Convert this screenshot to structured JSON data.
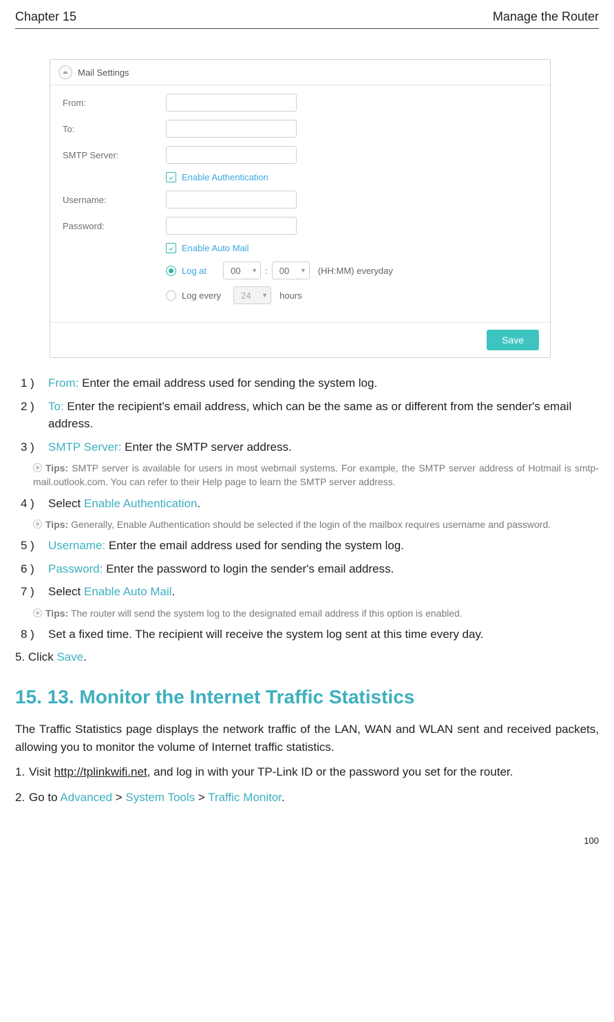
{
  "header": {
    "chapter": "Chapter 15",
    "title": "Manage the Router"
  },
  "panel": {
    "title": "Mail Settings",
    "labels": {
      "from": "From:",
      "to": "To:",
      "smtp": "SMTP Server:",
      "enable_auth": "Enable Authentication",
      "username": "Username:",
      "password": "Password:",
      "enable_automail": "Enable Auto Mail",
      "log_at": "Log at",
      "hh": "00",
      "mm": "00",
      "hhmm_suffix": "(HH:MM) everyday",
      "log_every": "Log every",
      "every_val": "24",
      "every_unit": "hours",
      "save": "Save"
    }
  },
  "steps_sub": [
    {
      "n": "1 )",
      "label": "From:",
      "text": " Enter the email address used for sending the system log."
    },
    {
      "n": "2 )",
      "label": "To:",
      "text": " Enter the recipient's email address, which can be the same as or different from the sender's email address."
    },
    {
      "n": "3 )",
      "label": "SMTP Server:",
      "text": " Enter the SMTP server address."
    }
  ],
  "tips1": {
    "label": "Tips:",
    "text": " SMTP server is available for users in most webmail systems. For example, the SMTP server address of Hotmail is smtp-mail.outlook.com. You can refer to their Help page to learn the SMTP server address."
  },
  "step4": {
    "n": "4 )",
    "pre": "Select ",
    "label": "Enable Authentication",
    "post": "."
  },
  "tips2": {
    "label": "Tips:",
    "text": " Generally, Enable Authentication should be selected if the login of the mailbox requires username and password."
  },
  "steps_sub2": [
    {
      "n": "5 )",
      "label": "Username:",
      "text": " Enter the email address used for sending the system log."
    },
    {
      "n": "6 )",
      "label": "Password:",
      "text": " Enter the password to login the sender's email address."
    }
  ],
  "step7": {
    "n": "7 )",
    "pre": "Select ",
    "label": "Enable Auto Mail",
    "post": "."
  },
  "tips3": {
    "label": "Tips:",
    "text": " The router will send the system log to the designated email address if this option is enabled."
  },
  "step8": {
    "n": "8 )",
    "text": "Set a fixed time. The recipient will receive the system log sent at this time every day."
  },
  "step5outer": {
    "pre": "5. Click ",
    "label": "Save",
    "post": "."
  },
  "section_heading": "15. 13.  Monitor the Internet Traffic Statistics",
  "section_para": "The Traffic Statistics page displays the network traffic of the LAN, WAN and WLAN sent and received packets, allowing you to monitor the volume of Internet traffic statistics.",
  "final_steps": {
    "s1": {
      "n": "1.",
      "pre": "Visit ",
      "link": "http://tplinkwifi.net",
      "post": ", and log in with your TP-Link ID or the password you set for the router."
    },
    "s2": {
      "n": "2.",
      "pre": "Go to ",
      "a": "Advanced",
      "gt1": " > ",
      "b": "System Tools",
      "gt2": " > ",
      "c": "Traffic Monitor",
      "post": "."
    }
  },
  "page_number": "100"
}
